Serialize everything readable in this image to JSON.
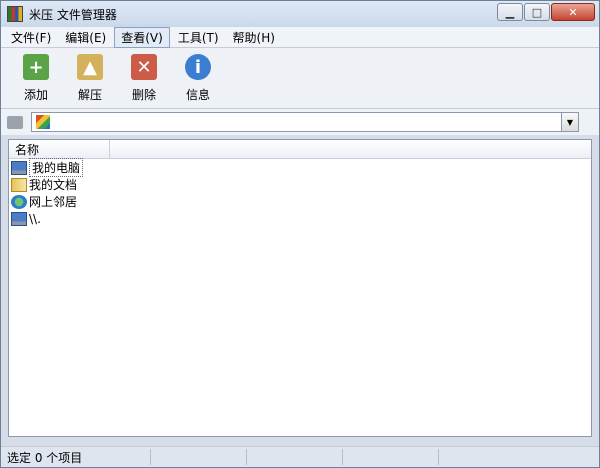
{
  "window": {
    "title": "米压 文件管理器"
  },
  "menu": [
    "文件(F)",
    "编辑(E)",
    "查看(V)",
    "工具(T)",
    "帮助(H)"
  ],
  "toolbar": {
    "add": "添加",
    "extract": "解压",
    "delete": "删除",
    "info": "信息"
  },
  "address": {
    "value": ""
  },
  "list": {
    "header": "名称",
    "items": [
      {
        "label": "我的电脑",
        "icon": "computer-icon"
      },
      {
        "label": "我的文档",
        "icon": "documents-folder-icon"
      },
      {
        "label": "网上邻居",
        "icon": "network-icon"
      },
      {
        "label": "\\\\.",
        "icon": "computer-icon"
      }
    ]
  },
  "status": {
    "text": "选定 0 个项目"
  }
}
